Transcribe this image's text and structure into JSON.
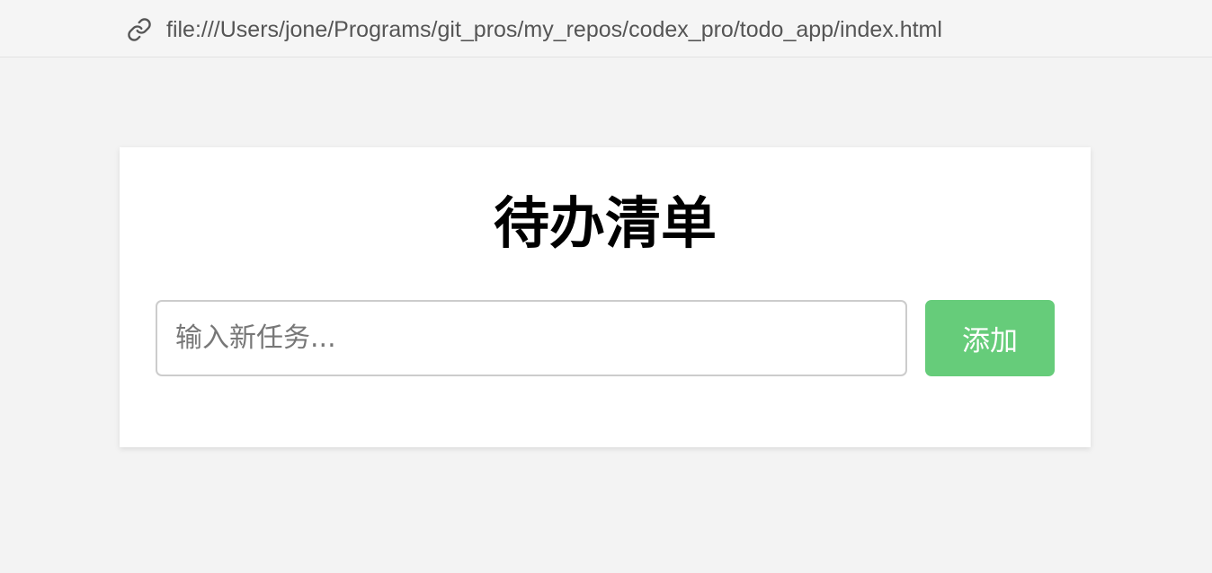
{
  "address_bar": {
    "url": "file:///Users/jone/Programs/git_pros/my_repos/codex_pro/todo_app/index.html",
    "icon": "link-icon"
  },
  "todo": {
    "title": "待办清单",
    "input_placeholder": "输入新任务...",
    "input_value": "",
    "add_button_label": "添加"
  },
  "colors": {
    "page_background": "#f3f3f3",
    "card_background": "#ffffff",
    "button_background": "#66cc7a",
    "button_text": "#ffffff"
  }
}
